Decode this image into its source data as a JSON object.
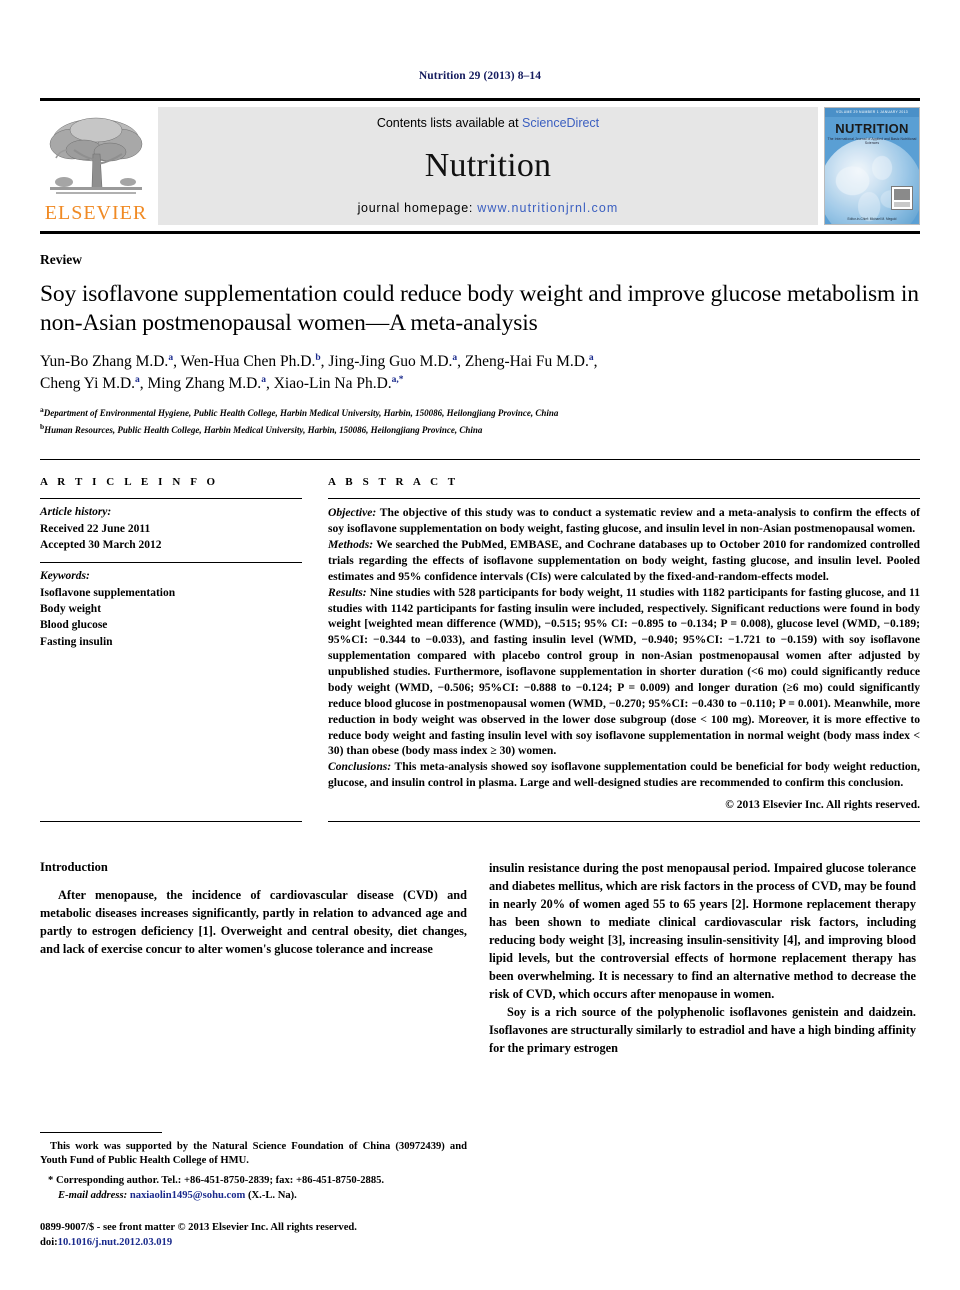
{
  "running_head": "Nutrition 29 (2013) 8–14",
  "masthead": {
    "contents_prefix": "Contents lists available at ",
    "sciencedirect": "ScienceDirect",
    "journal_name": "Nutrition",
    "homepage_prefix": "journal homepage: ",
    "homepage_url": "www.nutritionjrnl.com",
    "publisher_logo_text": "ELSEVIER",
    "cover": {
      "top_strip": "VOLUME 29 NUMBER 1 JANUARY 2013",
      "title": "NUTRITION",
      "subtitle": "The International Journal of Applied and Basic Nutritional Sciences",
      "footer": "Editor-in-Chief: Michael M. Meguid"
    },
    "accent_link_color": "#3b5fc0",
    "elsevier_orange": "#f08a24",
    "cover_blue": "#5a9fd4"
  },
  "article": {
    "section_type": "Review",
    "title": "Soy isoflavone supplementation could reduce body weight and improve glucose metabolism in non-Asian postmenopausal women—A meta-analysis",
    "authors_line_1": "Yun-Bo Zhang M.D. a, Wen-Hua Chen Ph.D. b, Jing-Jing Guo M.D. a, Zheng-Hai Fu M.D. a,",
    "authors_line_2": "Cheng Yi M.D. a, Ming Zhang M.D. a, Xiao-Lin Na Ph.D. a,*",
    "affiliation_a": "Department of Environmental Hygiene, Public Health College, Harbin Medical University, Harbin, 150086, Heilongjiang Province, China",
    "affiliation_b": "Human Resources, Public Health College, Harbin Medical University, Harbin, 150086, Heilongjiang Province, China",
    "affiliation_a_marker": "a",
    "affiliation_b_marker": "b"
  },
  "article_info": {
    "heading": "A R T I C L E   I N F O",
    "history_label": "Article history:",
    "received": "Received 22 June 2011",
    "accepted": "Accepted 30 March 2012",
    "keywords_label": "Keywords:",
    "keywords": [
      "Isoflavone supplementation",
      "Body weight",
      "Blood glucose",
      "Fasting insulin"
    ]
  },
  "abstract": {
    "heading": "A B S T R A C T",
    "objective_label": "Objective:",
    "objective_text": " The objective of this study was to conduct a systematic review and a meta-analysis to confirm the effects of soy isoflavone supplementation on body weight, fasting glucose, and insulin level in non-Asian postmenopausal women.",
    "methods_label": "Methods:",
    "methods_text": " We searched the PubMed, EMBASE, and Cochrane databases up to October 2010 for randomized controlled trials regarding the effects of isoflavone supplementation on body weight, fasting glucose, and insulin level. Pooled estimates and 95% confidence intervals (CIs) were calculated by the fixed-and-random-effects model.",
    "results_label": "Results:",
    "results_text": " Nine studies with 528 participants for body weight, 11 studies with 1182 participants for fasting glucose, and 11 studies with 1142 participants for fasting insulin were included, respectively. Significant reductions were found in body weight [weighted mean difference (WMD), −0.515; 95% CI: −0.895 to −0.134; P = 0.008), glucose level (WMD, −0.189; 95%CI: −0.344 to −0.033), and fasting insulin level (WMD, −0.940; 95%CI: −1.721 to −0.159) with soy isoflavone supplementation compared with placebo control group in non-Asian postmenopausal women after adjusted by unpublished studies. Furthermore, isoflavone supplementation in shorter duration (<6 mo) could significantly reduce body weight (WMD, −0.506; 95%CI: −0.888 to −0.124; P = 0.009) and longer duration (≥6 mo) could significantly reduce blood glucose in postmenopausal women (WMD, −0.270; 95%CI: −0.430 to −0.110; P = 0.001). Meanwhile, more reduction in body weight was observed in the lower dose subgroup (dose < 100 mg). Moreover, it is more effective to reduce body weight and fasting insulin level with soy isoflavone supplementation in normal weight (body mass index < 30) than obese (body mass index ≥ 30) women.",
    "conclusions_label": "Conclusions:",
    "conclusions_text": " This meta-analysis showed soy isoflavone supplementation could be beneficial for body weight reduction, glucose, and insulin control in plasma. Large and well-designed studies are recommended to confirm this conclusion.",
    "copyright": "© 2013 Elsevier Inc. All rights reserved."
  },
  "introduction": {
    "heading": "Introduction",
    "para_1": "After menopause, the incidence of cardiovascular disease (CVD) and metabolic diseases increases significantly, partly in relation to advanced age and partly to estrogen deficiency [1]. Overweight and central obesity, diet changes, and lack of exercise concur to alter women's glucose tolerance and increase insulin resistance during the post menopausal period. Impaired glucose tolerance and diabetes mellitus, which are risk factors in the process of CVD, may be found in nearly 20% of women aged 55 to 65 years [2]. Hormone replacement therapy has been shown to mediate clinical cardiovascular risk factors, including reducing body weight [3], increasing insulin-sensitivity [4], and improving blood lipid levels, but the controversial effects of hormone replacement therapy has been overwhelming. It is necessary to find an alternative method to decrease the risk of CVD, which occurs after menopause in women.",
    "para_2": "Soy is a rich source of the polyphenolic isoflavones genistein and daidzein. Isoflavones are structurally similarly to estradiol and have a high binding affinity for the primary estrogen",
    "col_left_text": "After menopause, the incidence of cardiovascular disease (CVD) and metabolic diseases increases significantly, partly in relation to advanced age and partly to estrogen deficiency [1]. Overweight and central obesity, diet changes, and lack of exercise concur to alter women's glucose tolerance and increase",
    "col_right_text_1": "insulin resistance during the post menopausal period. Impaired glucose tolerance and diabetes mellitus, which are risk factors in the process of CVD, may be found in nearly 20% of women aged 55 to 65 years [2]. Hormone replacement therapy has been shown to mediate clinical cardiovascular risk factors, including reducing body weight [3], increasing insulin-sensitivity [4], and improving blood lipid levels, but the controversial effects of hormone replacement therapy has been overwhelming. It is necessary to find an alternative method to decrease the risk of CVD, which occurs after menopause in women.",
    "col_right_text_2": "Soy is a rich source of the polyphenolic isoflavones genistein and daidzein. Isoflavones are structurally similarly to estradiol and have a high binding affinity for the primary estrogen"
  },
  "footnotes": {
    "funding": "This work was supported by the Natural Science Foundation of China (30972439) and Youth Fund of Public Health College of HMU.",
    "corresponding": "* Corresponding author. Tel.: +86-451-8750-2839; fax: +86-451-8750-2885.",
    "email_label": "E-mail address:",
    "email": "naxiaolin1495@sohu.com",
    "email_suffix": " (X.-L. Na).",
    "issn_line": "0899-9007/$ - see front matter © 2013 Elsevier Inc. All rights reserved.",
    "doi_label": "doi:",
    "doi": "10.1016/j.nut.2012.03.019"
  }
}
